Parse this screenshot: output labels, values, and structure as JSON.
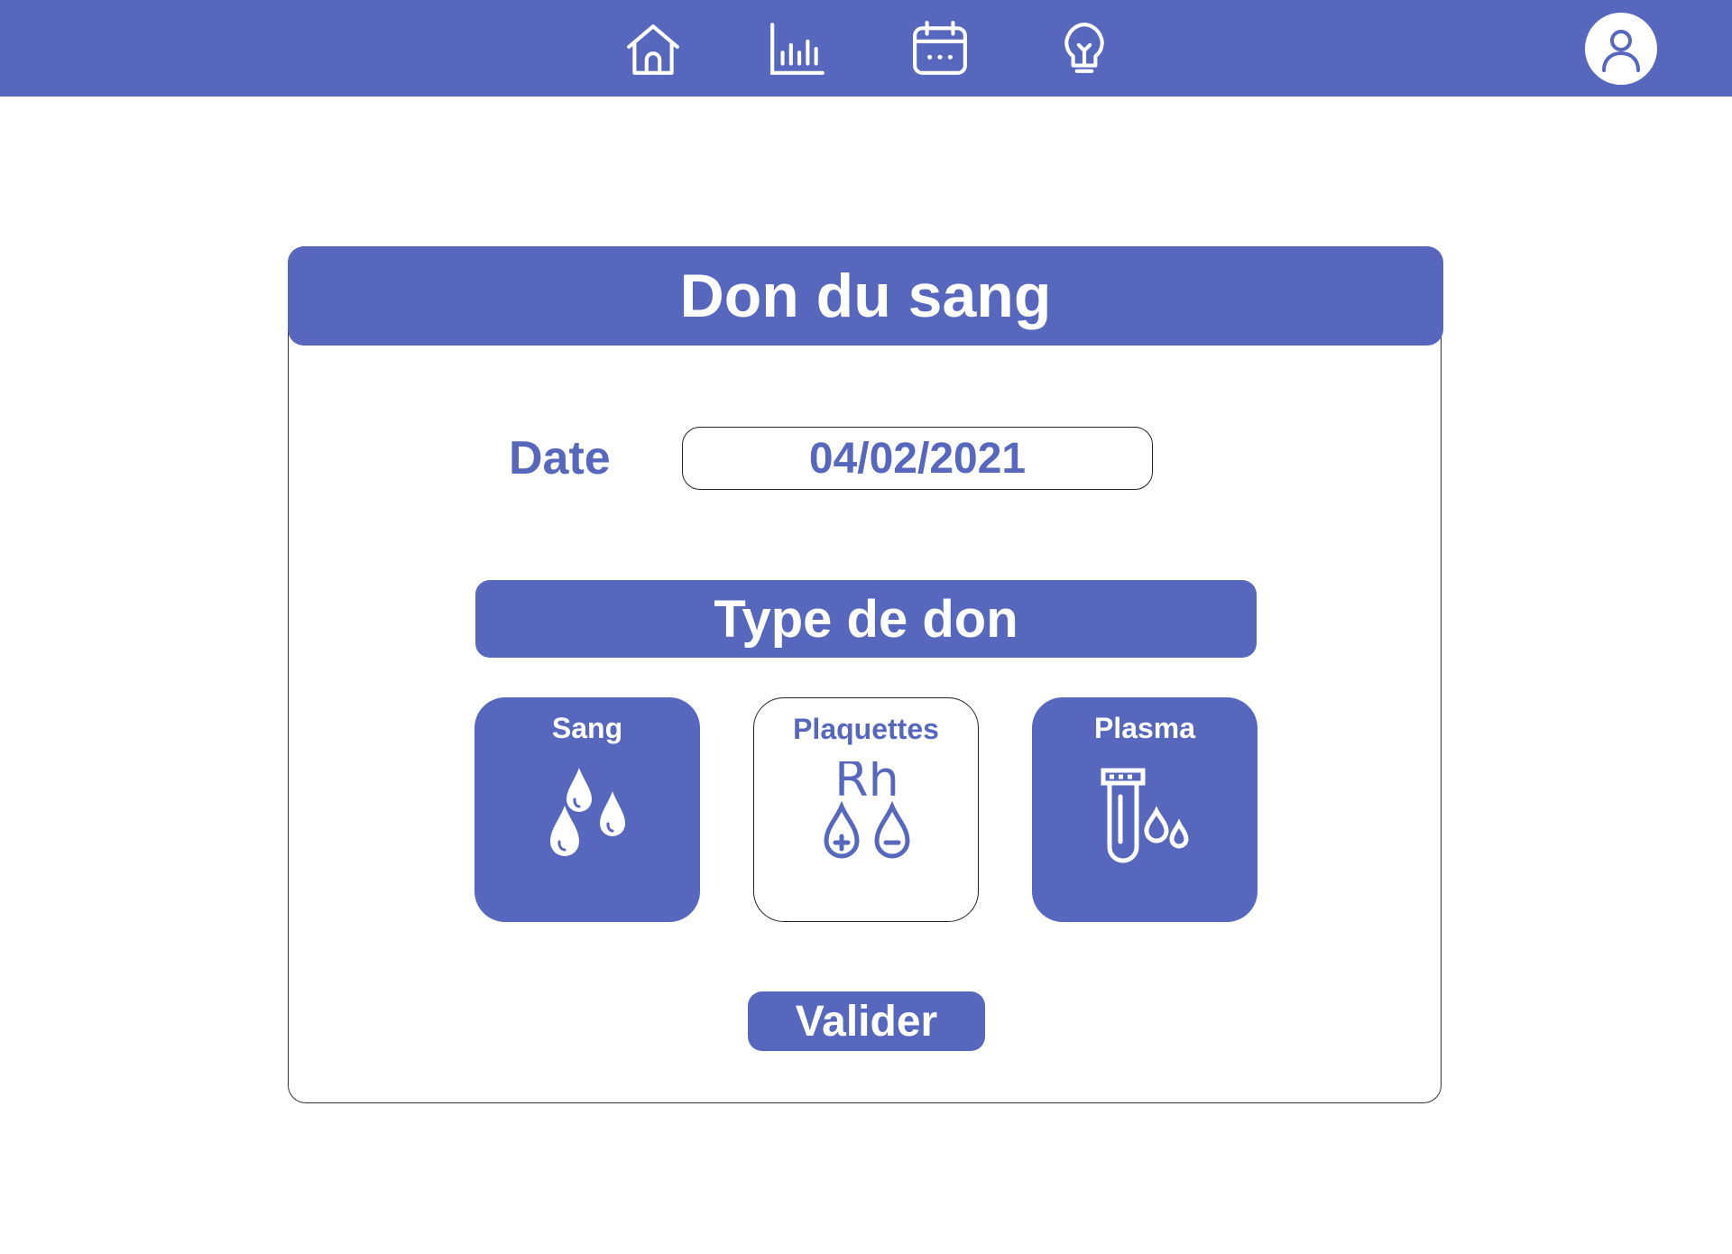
{
  "nav": {
    "icons": [
      "home-icon",
      "chart-icon",
      "calendar-icon",
      "lightbulb-icon"
    ],
    "profile_icon": "user-icon"
  },
  "colors": {
    "accent": "#5767be",
    "background": "#ffffff",
    "text_on_accent": "#ffffff"
  },
  "form": {
    "title": "Don du sang",
    "date_label": "Date",
    "date_value": "04/02/2021",
    "type_header": "Type de don",
    "options": [
      {
        "label": "Sang",
        "icon": "blood-drops-icon",
        "selected": true
      },
      {
        "label": "Plaquettes",
        "icon": "rh-factor-icon",
        "selected": false
      },
      {
        "label": "Plasma",
        "icon": "test-tube-icon",
        "selected": true
      }
    ],
    "icon_text_rh": "Rh",
    "submit_label": "Valider"
  }
}
